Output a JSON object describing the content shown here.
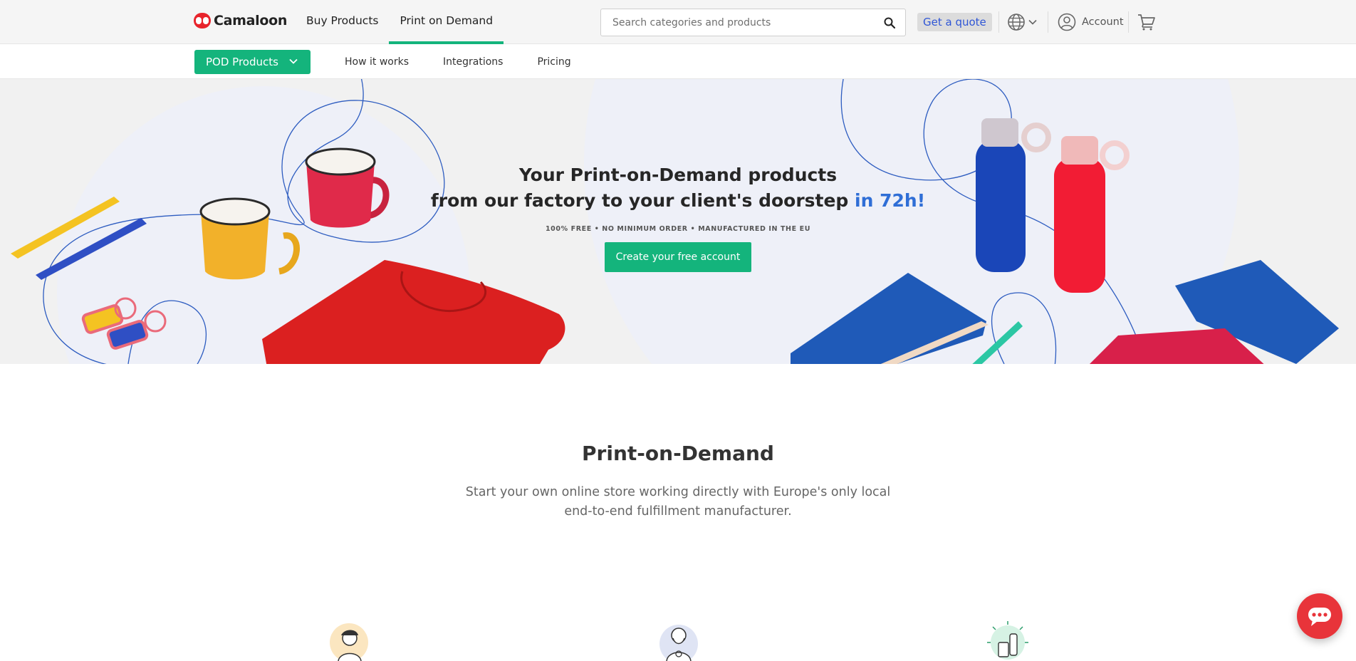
{
  "header": {
    "logo_text": "Camaloon",
    "nav": [
      {
        "label": "Buy Products"
      },
      {
        "label": "Print on Demand"
      }
    ],
    "search_placeholder": "Search categories and products",
    "quote_label": "Get a quote",
    "account_label": "Account",
    "icons": [
      "search-icon",
      "globe-icon",
      "chevron-down-icon",
      "user-icon",
      "cart-icon"
    ]
  },
  "subnav": {
    "pod_button": "POD Products",
    "items": [
      {
        "label": "How it works"
      },
      {
        "label": "Integrations"
      },
      {
        "label": "Pricing"
      }
    ]
  },
  "hero": {
    "title_line1": "Your Print-on-Demand products",
    "title_line2": "from our factory to your client's doorstep",
    "title_accent": "in 72h!",
    "subtitle": "100% FREE • NO MINIMUM ORDER • MANUFACTURED IN THE EU",
    "cta": "Create your free account"
  },
  "section": {
    "title": "Print-on-Demand",
    "text": "Start your own online store working directly with Europe's only local end-to-end fulfillment manufacturer."
  },
  "colors": {
    "brand_green": "#14b47c",
    "accent_blue": "#2f6ed6",
    "brand_red": "#e8242c"
  }
}
